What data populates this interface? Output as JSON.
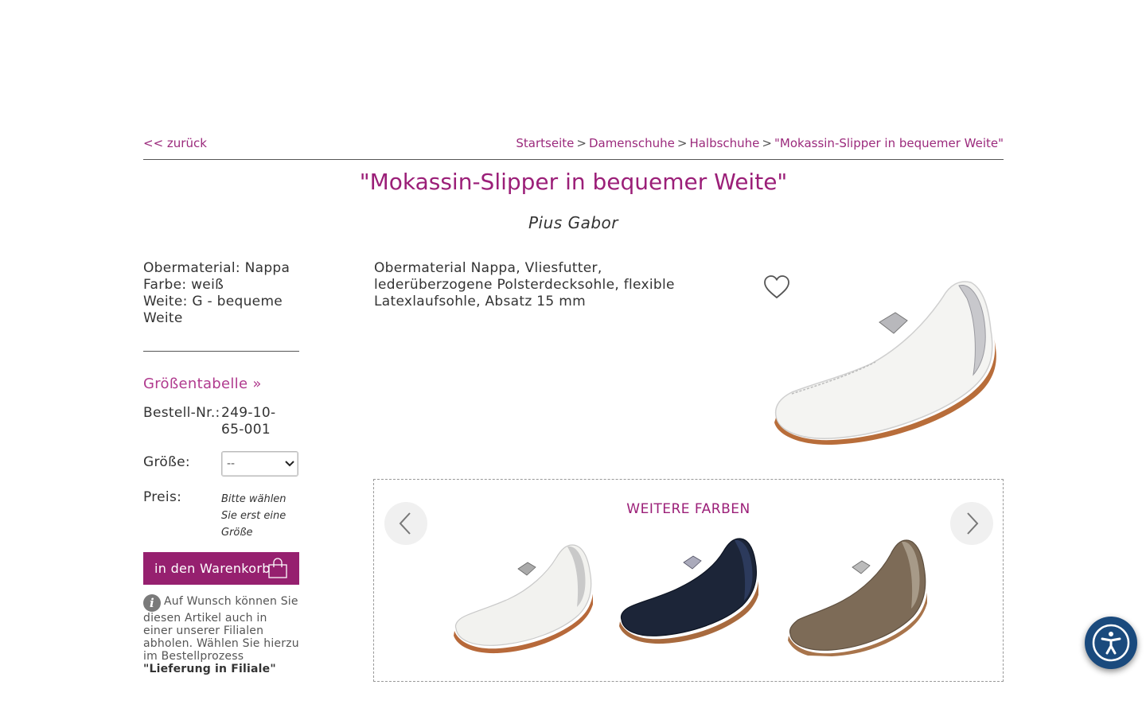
{
  "nav": {
    "back_label": "<< zurück",
    "breadcrumb": [
      "Startseite",
      "Damenschuhe",
      "Halbschuhe",
      "\"Mokassin-Slipper in bequemer Weite\""
    ],
    "separator": ">"
  },
  "product": {
    "title": "\"Mokassin-Slipper in bequemer Weite\"",
    "brand": "Pius Gabor",
    "specs": [
      "Obermaterial: Nappa",
      "Farbe: weiß",
      "Weite: G - bequeme Weite"
    ],
    "description": "Obermaterial Nappa, Vliesfutter, lederüberzogene Polsterdecksohle, flexible Latexlaufsohle, Absatz 15 mm"
  },
  "purchase": {
    "size_table_link": "Größentabelle »",
    "order_number_label": "Bestell-Nr.:",
    "order_number": "249-10-65-001",
    "size_label": "Größe:",
    "size_selected": "--",
    "price_label": "Preis:",
    "price_note": "Bitte wählen Sie erst eine Größe",
    "cart_button": "in den Warenkorb"
  },
  "info": {
    "icon": "info-icon",
    "text": "Auf Wunsch können Sie diesen Artikel auch in einer unserer Filialen abholen. Wählen Sie hierzu im Bestellprozess ",
    "bold": "\"Lieferung in Filiale\""
  },
  "more_colors": {
    "title": "WEITERE FARBEN",
    "variants": [
      {
        "name": "weiß",
        "upper": "#f2f2ef",
        "trim": "#c9c9c9",
        "sole": "#b7693a"
      },
      {
        "name": "dunkelblau",
        "upper": "#1c2538",
        "trim": "#2c3a5c",
        "sole": "#a86a3e"
      },
      {
        "name": "taupe",
        "upper": "#7d6b57",
        "trim": "#a79a88",
        "sole": "#a8744b"
      }
    ]
  },
  "colors": {
    "accent": "#9b1f78",
    "button": "#96206f",
    "a11y": "#1a4a7d"
  }
}
